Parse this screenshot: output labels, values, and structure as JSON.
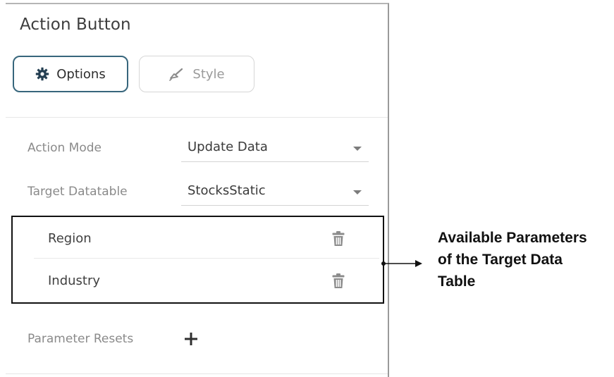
{
  "panel": {
    "title": "Action Button",
    "tabs": [
      {
        "label": "Options",
        "icon": "gear-icon",
        "active": true
      },
      {
        "label": "Style",
        "icon": "paint-brush-icon",
        "active": false
      }
    ]
  },
  "fields": {
    "action_mode": {
      "label": "Action Mode",
      "value": "Update Data"
    },
    "target_datatable": {
      "label": "Target Datatable",
      "value": "StocksStatic"
    }
  },
  "parameters": [
    {
      "label": "Region",
      "icon": "trash-icon"
    },
    {
      "label": "Industry",
      "icon": "trash-icon"
    }
  ],
  "parameter_resets": {
    "label": "Parameter Resets",
    "icon": "plus-icon"
  },
  "callout": {
    "lines": [
      "Available Parameters",
      "of the Target Data",
      "Table"
    ]
  },
  "colors": {
    "accent_border": "#37667c",
    "icon_gray": "#8c8c8c",
    "text_dark": "#3f3f3f",
    "text_label": "#8a8a8a"
  }
}
